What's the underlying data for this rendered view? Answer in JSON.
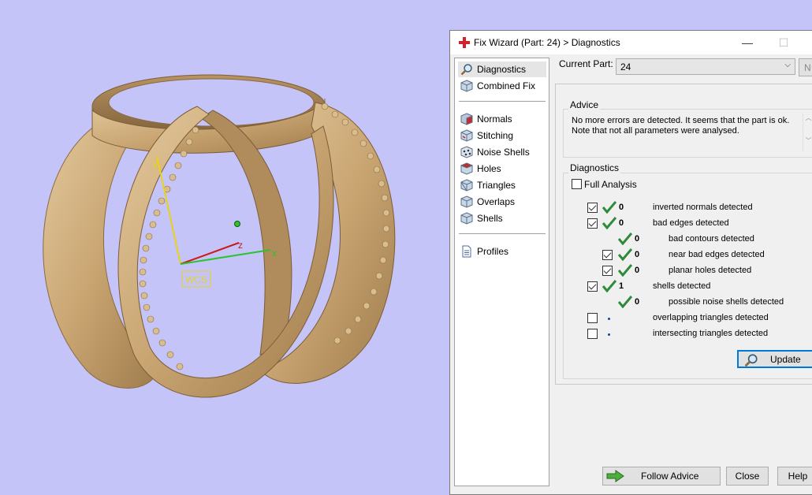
{
  "viewport": {
    "background": "#c4c4f8",
    "ring_color": "#d2b184",
    "axis_labels": {
      "y": "y",
      "z": "z",
      "x": "x"
    },
    "wcs_label": "WCS"
  },
  "dialog": {
    "title": "Fix Wizard (Part: 24) > Diagnostics",
    "minimize_glyph": "—",
    "maximize_glyph": "☐"
  },
  "nav": {
    "items": [
      {
        "label": "Diagnostics",
        "icon": "magnifier-icon",
        "selected": true
      },
      {
        "label": "Combined Fix",
        "icon": "cube-icon"
      },
      {
        "label": "Normals",
        "icon": "normals-cube-icon"
      },
      {
        "label": "Stitching",
        "icon": "stitching-cube-icon"
      },
      {
        "label": "Noise Shells",
        "icon": "noise-shells-icon"
      },
      {
        "label": "Holes",
        "icon": "holes-cube-icon"
      },
      {
        "label": "Triangles",
        "icon": "triangles-cube-icon"
      },
      {
        "label": "Overlaps",
        "icon": "overlaps-cube-icon"
      },
      {
        "label": "Shells",
        "icon": "shells-cube-icon"
      },
      {
        "label": "Profiles",
        "icon": "document-icon"
      }
    ]
  },
  "current_part": {
    "label": "Current Part:",
    "value": "24",
    "next_button": "N"
  },
  "advice": {
    "title": "Advice",
    "text_line1": "No more errors are detected. It seems that the part is ok.",
    "text_line2": "Note that not all parameters were analysed."
  },
  "diagnostics": {
    "title": "Diagnostics",
    "full_analysis_label": "Full Analysis",
    "full_analysis_checked": false,
    "rows": [
      {
        "checkbox": true,
        "checked": true,
        "status": "ok",
        "count": "0",
        "label": "inverted normals detected"
      },
      {
        "checkbox": true,
        "checked": true,
        "status": "ok",
        "count": "0",
        "label": "bad edges detected"
      },
      {
        "checkbox": false,
        "status": "ok",
        "count": "0",
        "label": "bad contours detected"
      },
      {
        "checkbox": true,
        "checked": true,
        "status": "ok",
        "count": "0",
        "label": "near bad edges detected"
      },
      {
        "checkbox": true,
        "checked": true,
        "status": "ok",
        "count": "0",
        "label": "planar holes detected"
      },
      {
        "checkbox": true,
        "checked": true,
        "status": "ok",
        "count": "1",
        "label": "shells detected"
      },
      {
        "checkbox": false,
        "status": "ok",
        "count": "0",
        "label": "possible noise shells detected"
      },
      {
        "checkbox": true,
        "checked": false,
        "status": "pending",
        "count": "",
        "label": "overlapping triangles detected"
      },
      {
        "checkbox": true,
        "checked": false,
        "status": "pending",
        "count": "",
        "label": "intersecting triangles detected"
      }
    ],
    "update_button": "Update"
  },
  "buttons": {
    "follow_advice": "Follow Advice",
    "close": "Close",
    "help": "Help"
  },
  "colors": {
    "check_green": "#2e8b3a",
    "accent_blue": "#0078d7",
    "close_icon_red": "#d3202a"
  }
}
